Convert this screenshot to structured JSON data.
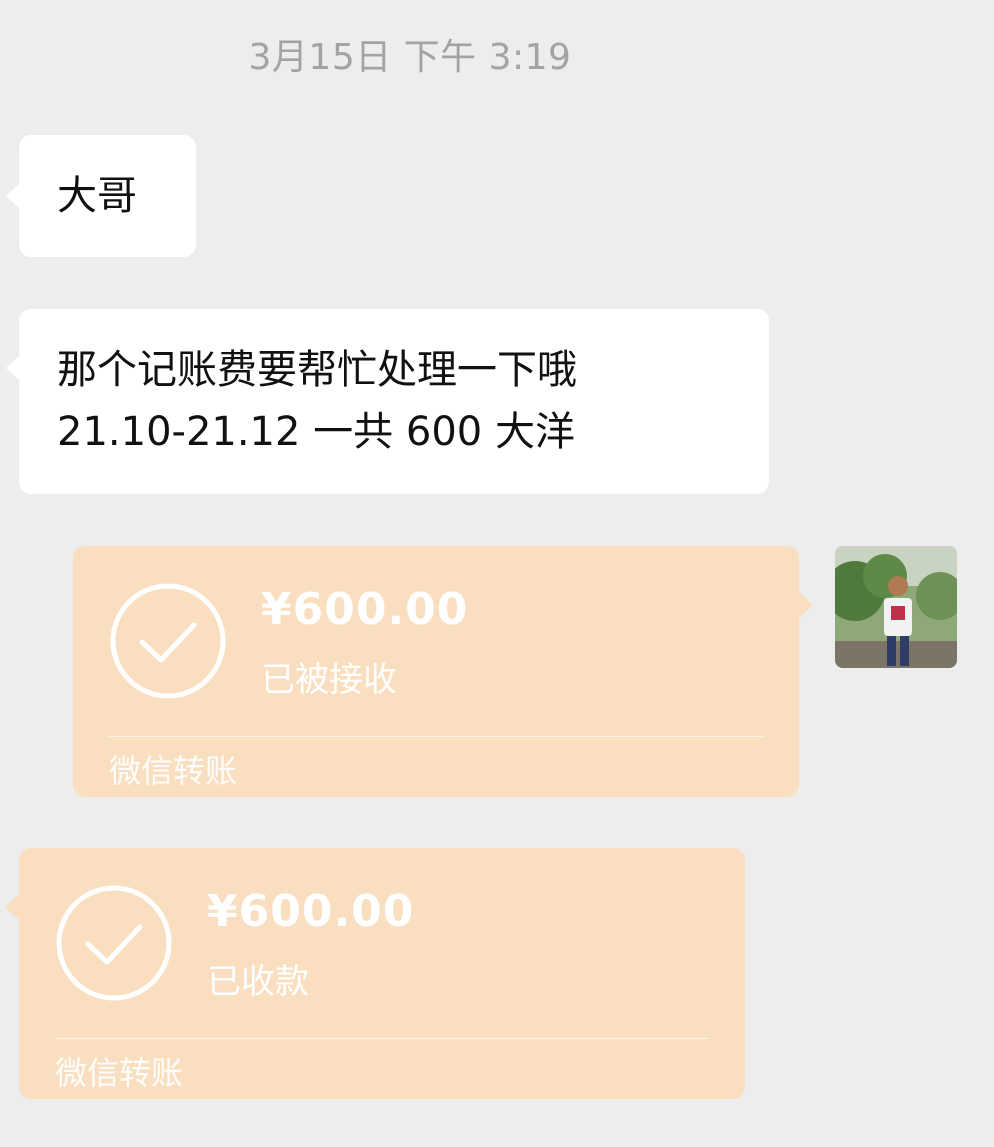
{
  "chat": {
    "timestamp": "3月15日 下午 3:19",
    "messages": [
      {
        "sender": "other",
        "type": "text",
        "lines": [
          "大哥"
        ]
      },
      {
        "sender": "other",
        "type": "text",
        "lines": [
          "那个记账费要帮忙处理一下哦",
          "21.10-21.12  一共 600 大洋"
        ]
      },
      {
        "sender": "self",
        "type": "transfer",
        "amount": "¥600.00",
        "status": "已被接收",
        "label": "微信转账"
      },
      {
        "sender": "other",
        "type": "transfer",
        "amount": "¥600.00",
        "status": "已收款",
        "label": "微信转账"
      }
    ]
  },
  "icons": {
    "transfer_status": "check-circle-icon",
    "self_avatar": "avatar"
  },
  "colors": {
    "background": "#ededed",
    "incoming_bubble": "#ffffff",
    "transfer_bubble": "#f9dfc0",
    "timestamp": "#a3a3a3"
  }
}
